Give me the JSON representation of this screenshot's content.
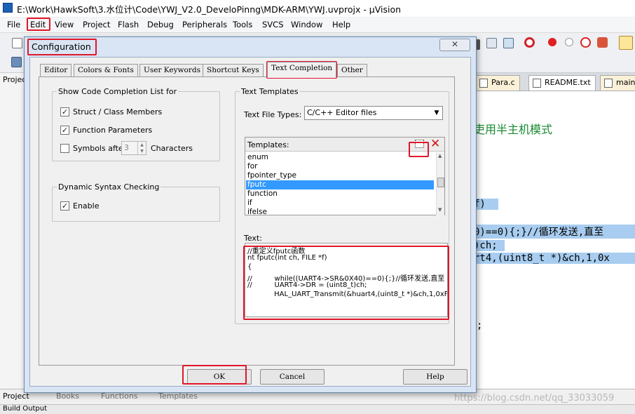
{
  "window": {
    "title": "E:\\Work\\HawkSoft\\3.水位计\\Code\\YWJ_V2.0_DeveloPinng\\MDK-ARM\\YWJ.uvprojx - µVision"
  },
  "menu": [
    "File",
    "Edit",
    "View",
    "Project",
    "Flash",
    "Debug",
    "Peripherals",
    "Tools",
    "SVCS",
    "Window",
    "Help"
  ],
  "toolbar": {
    "project_label": "Project"
  },
  "file_tabs": [
    "Para.c",
    "README.txt",
    "main"
  ],
  "code_lines": {
    "l1": "吏用半主机模式",
    "l2": "f)",
    "l3": "0)==0){;}//循环发送,直至",
    "l4": ")ch;",
    "l5": "rt4,(uint8_t *)&ch,1,0x",
    "l6": ";"
  },
  "bottom_tabs": [
    "Project",
    "Books",
    "Functions",
    "Templates"
  ],
  "build_output_label": "Build Output",
  "watermark": "https://blog.csdn.net/qq_33033059",
  "dialog": {
    "title": "Configuration",
    "close_glyph": "✕",
    "tabs": [
      "Editor",
      "Colors & Fonts",
      "User Keywords",
      "Shortcut Keys",
      "Text Completion",
      "Other"
    ],
    "active_tab": "Text Completion",
    "show_completion": {
      "legend": "Show Code Completion List for",
      "struct_members": "Struct / Class Members",
      "function_params": "Function Parameters",
      "symbols_after": "Symbols after",
      "symbols_count": "3",
      "characters": "Characters"
    },
    "dynamic_syntax": {
      "legend": "Dynamic Syntax Checking",
      "enable": "Enable"
    },
    "text_templates": {
      "legend": "Text Templates",
      "file_types_label": "Text File Types:",
      "file_types_value": "C/C++ Editor files",
      "templates_label": "Templates:",
      "items": [
        "enum",
        "for",
        "fpointer_type",
        "fputc",
        "function",
        "if",
        "ifelse"
      ],
      "selected": "fputc",
      "text_label": "Text:",
      "text_lines": [
        "//重定义fputc函数",
        "nt fputc(int ch, FILE *f)",
        "{",
        "//          while((UART4->SR&0X40)==0){;}//循环发送,直至",
        "//          UART4->DR = (uint8_t)ch;",
        "            HAL_UART_Transmit(&huart4,(uint8_t *)&ch,1,0xF"
      ]
    },
    "buttons": {
      "ok": "OK",
      "cancel": "Cancel",
      "help": "Help"
    }
  }
}
